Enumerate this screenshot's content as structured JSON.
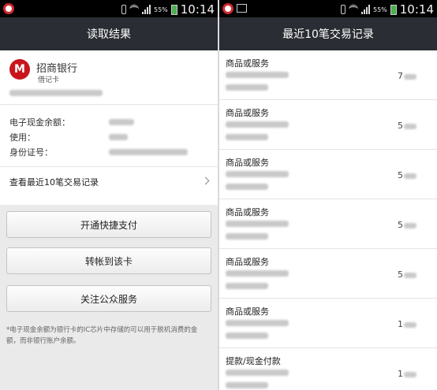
{
  "status_bar": {
    "time": "10:14",
    "battery": "55%"
  },
  "left_screen": {
    "title": "读取结果",
    "bank_logo_text": "M",
    "bank_name": "招商银行",
    "card_type": "借记卡",
    "info_labels": [
      "电子现金余额：",
      "使用：",
      "身份证号："
    ],
    "view_records_label": "查看最近10笔交易记录",
    "buttons": [
      "开通快捷支付",
      "转帐到该卡",
      "关注公众服务"
    ],
    "note": "*电子现金余额为银行卡的IC芯片中存储的可以用于脱机消费的金额，而非银行账户余额。"
  },
  "right_screen": {
    "title": "最近10笔交易记录",
    "transactions": [
      {
        "title": "商品或服务",
        "amount_prefix": "7"
      },
      {
        "title": "商品或服务",
        "amount_prefix": "5"
      },
      {
        "title": "商品或服务",
        "amount_prefix": "5"
      },
      {
        "title": "商品或服务",
        "amount_prefix": "5"
      },
      {
        "title": "商品或服务",
        "amount_prefix": "5"
      },
      {
        "title": "商品或服务",
        "amount_prefix": "1"
      },
      {
        "title": "提款/现金付款",
        "amount_prefix": "1"
      }
    ]
  }
}
